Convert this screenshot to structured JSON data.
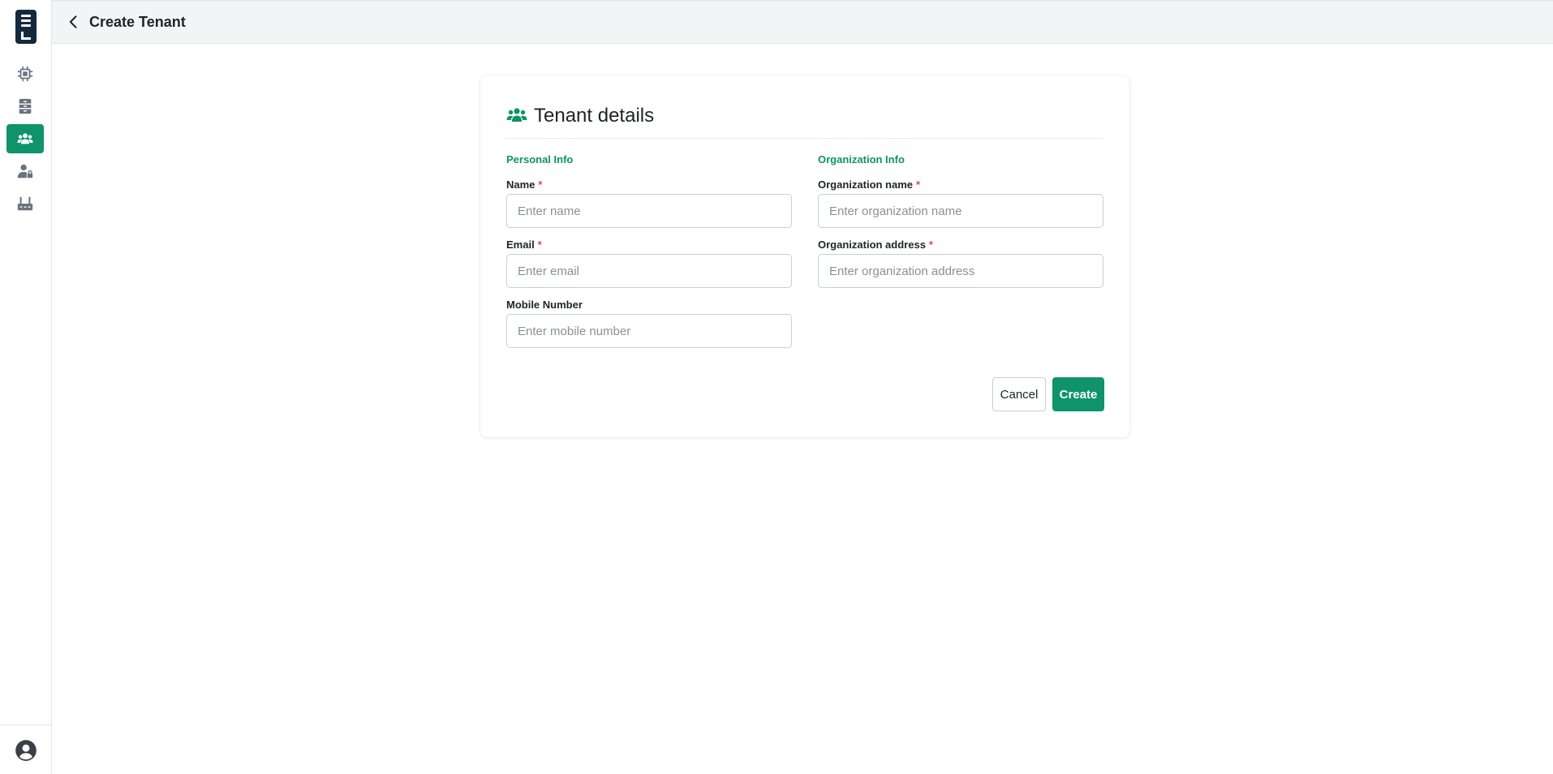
{
  "header": {
    "title": "Create Tenant"
  },
  "sidebar": {
    "items": [
      {
        "name": "chip-icon",
        "active": false
      },
      {
        "name": "server-icon",
        "active": false
      },
      {
        "name": "users-icon",
        "active": true
      },
      {
        "name": "user-lock-icon",
        "active": false
      },
      {
        "name": "router-icon",
        "active": false
      }
    ],
    "footer_icon": "user-circle-icon"
  },
  "card": {
    "title": "Tenant details",
    "personal": {
      "section": "Personal Info",
      "name_label": "Name",
      "name_placeholder": "Enter name",
      "email_label": "Email",
      "email_placeholder": "Enter email",
      "mobile_label": "Mobile Number",
      "mobile_placeholder": "Enter mobile number"
    },
    "organization": {
      "section": "Organization Info",
      "name_label": "Organization name",
      "name_placeholder": "Enter organization name",
      "address_label": "Organization address",
      "address_placeholder": "Enter organization address"
    },
    "required_mark": "*",
    "cancel_label": "Cancel",
    "create_label": "Create"
  },
  "colors": {
    "accent": "#0e9468",
    "logo": "#13293d",
    "required": "#e5484d"
  }
}
